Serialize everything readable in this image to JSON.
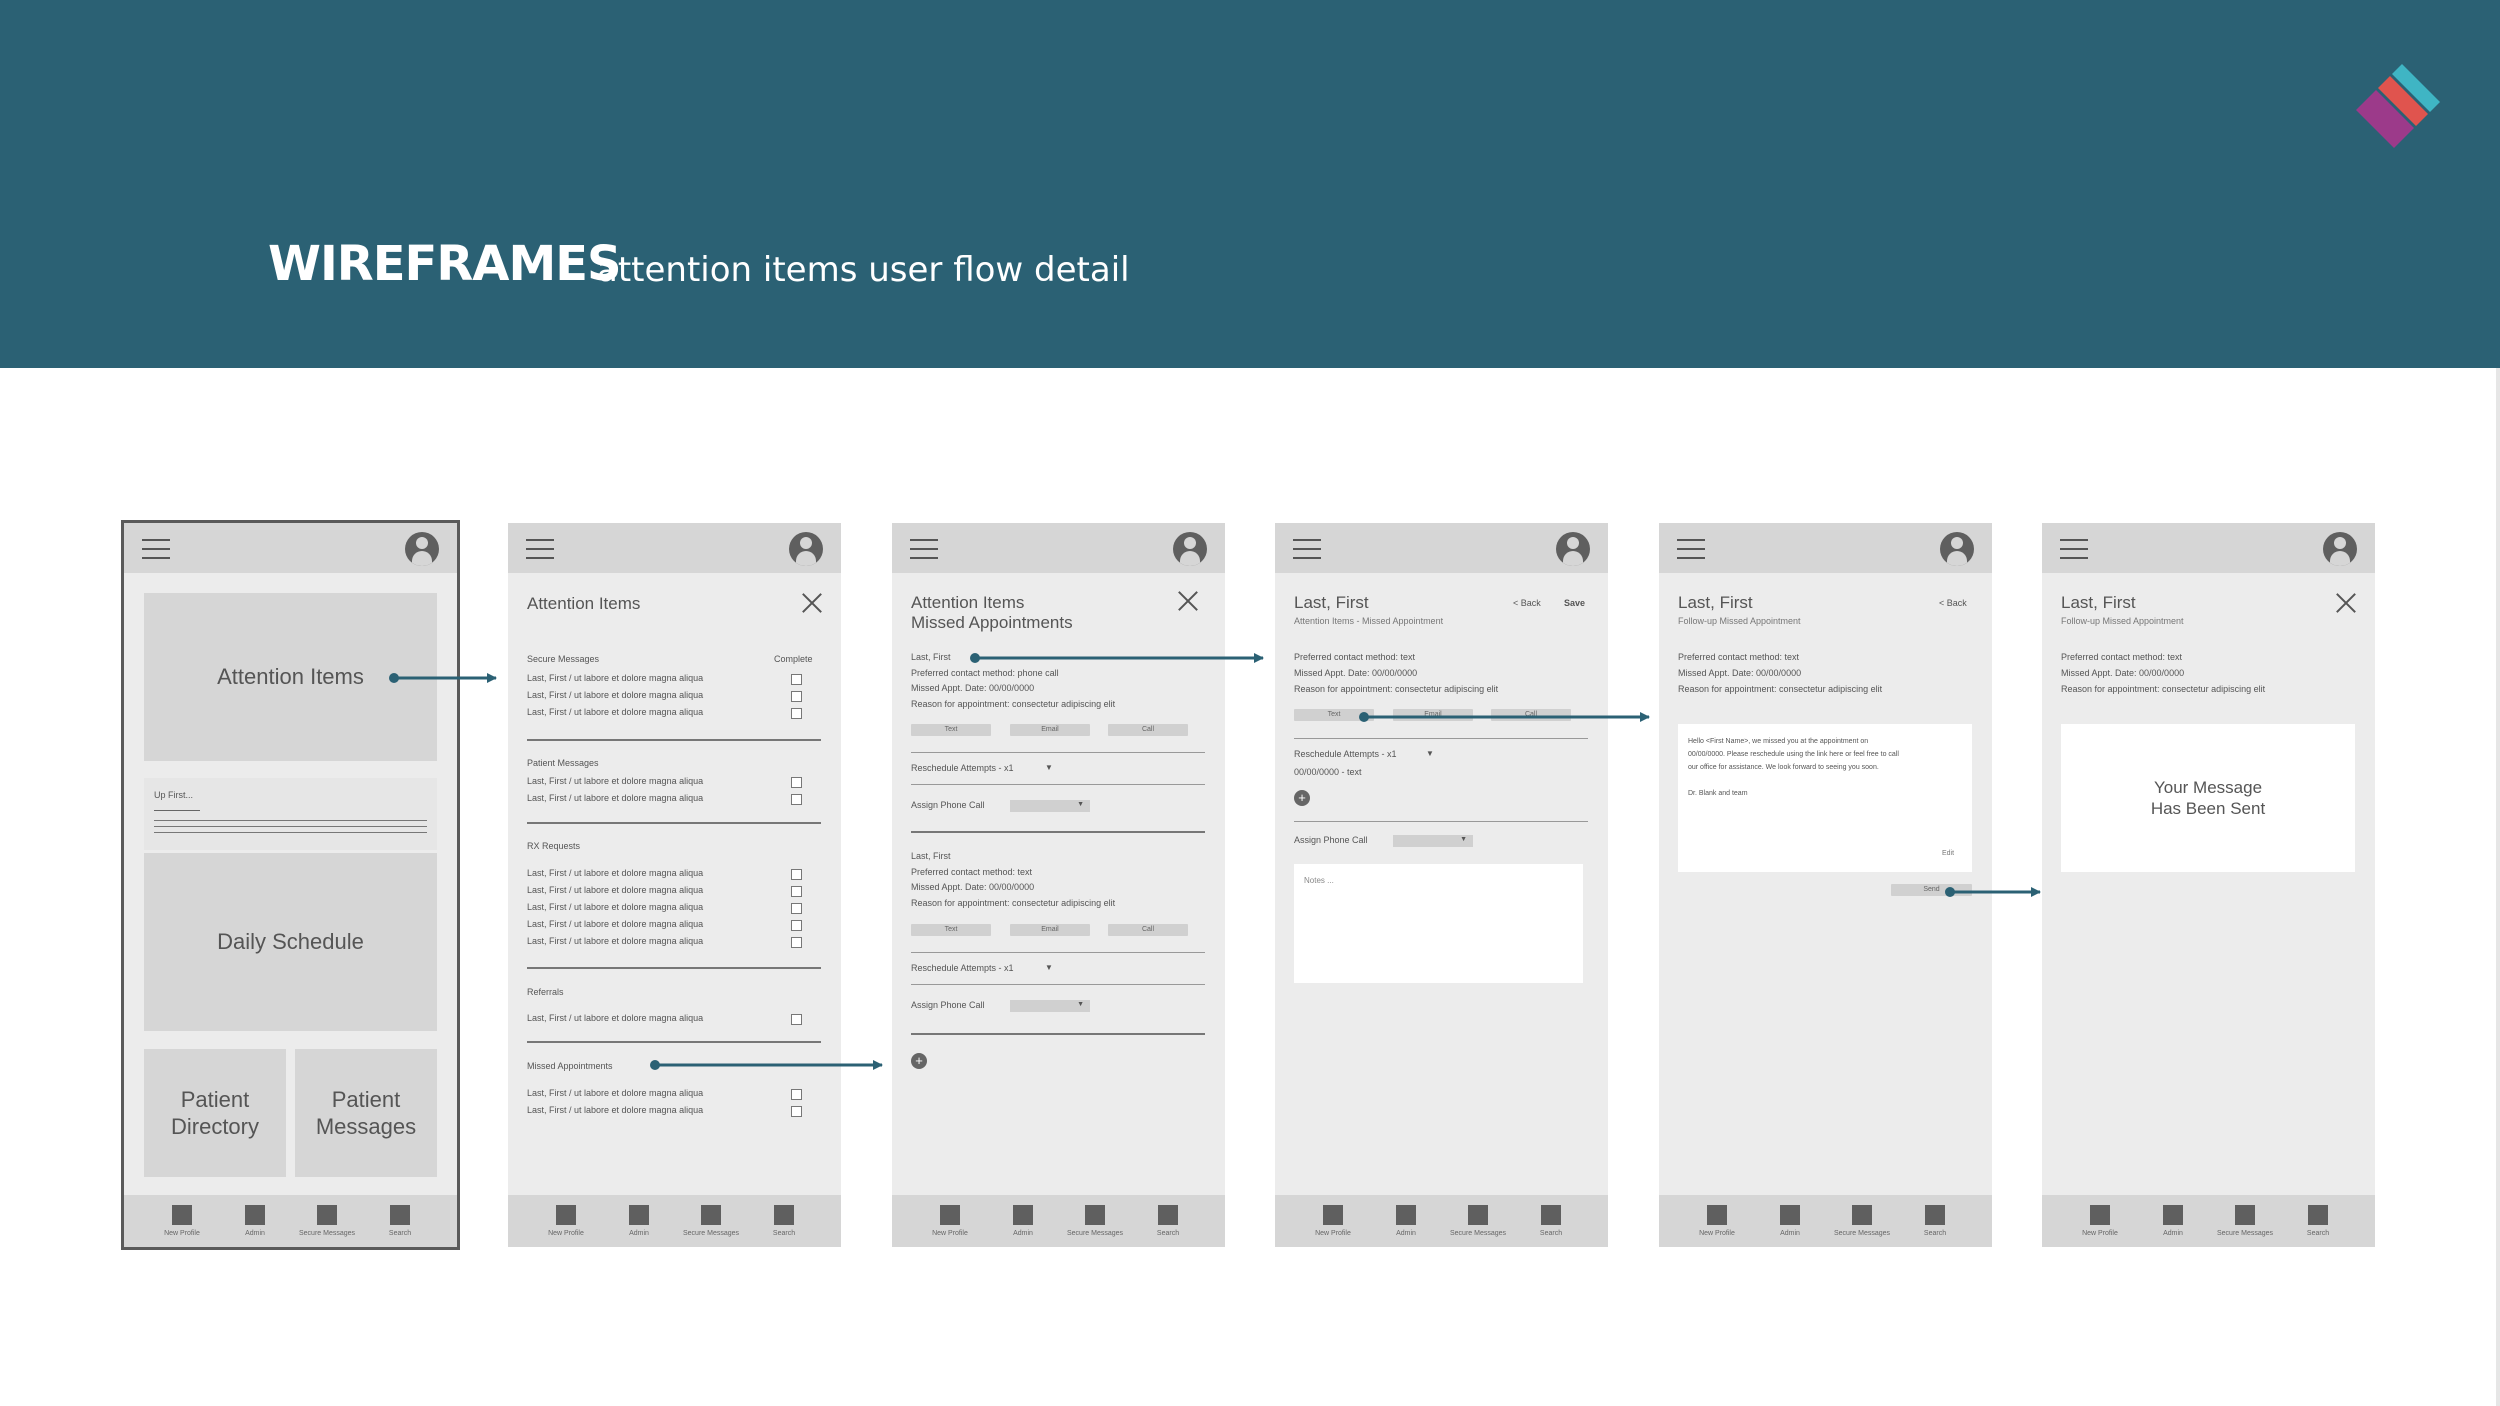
{
  "header": {
    "title": "WIREFRAMES",
    "subtitle": "attention items user flow detail"
  },
  "colors": {
    "banner": "#2b6174",
    "arrow": "#2b6174",
    "logo": [
      "#3fb5c4",
      "#e0544e",
      "#9c3a8a"
    ]
  },
  "nav_labels": [
    "New Profile",
    "Admin",
    "Secure Messages",
    "Search"
  ],
  "screen1": {
    "attention_items": "Attention Items",
    "up_first": "Up First...",
    "daily_schedule": "Daily Schedule",
    "patient_directory_1": "Patient",
    "patient_directory_2": "Directory",
    "patient_messages_1": "Patient",
    "patient_messages_2": "Messages"
  },
  "screen2": {
    "title": "Attention Items",
    "complete": "Complete",
    "item_text": "Last, First / ut labore et dolore magna aliqua",
    "sections": {
      "secure": "Secure Messages",
      "patient": "Patient Messages",
      "rx": "RX Requests",
      "referrals": "Referrals",
      "missed": "Missed Appointments"
    }
  },
  "screen3": {
    "title1": "Attention Items",
    "title2": "Missed Appointments",
    "name": "Last, First",
    "contact_phone": "Preferred contact method: phone call",
    "contact_text": "Preferred contact method: text",
    "missed_date": "Missed Appt. Date: 00/00/0000",
    "reason": "Reason for appointment: consectetur adipiscing elit",
    "btn_text": "Text",
    "btn_email": "Email",
    "btn_call": "Call",
    "reschedule": "Reschedule Attempts - x1",
    "assign": "Assign Phone Call"
  },
  "screen4": {
    "name": "Last, First",
    "sub": "Attention Items - Missed Appointment",
    "back": "< Back",
    "save": "Save",
    "contact": "Preferred contact method: text",
    "missed_date": "Missed Appt. Date: 00/00/0000",
    "reason": "Reason for appointment: consectetur adipiscing elit",
    "reschedule": "Reschedule Attempts - x1",
    "reschedule_entry": "00/00/0000 - text",
    "assign": "Assign Phone Call",
    "notes": "Notes ..."
  },
  "screen5": {
    "name": "Last, First",
    "sub": "Follow-up Missed Appointment",
    "back": "< Back",
    "msg1": "Hello <First Name>, we missed you at the appointment on",
    "msg2": "00/00/0000. Please reschedule using the link here or feel free to call",
    "msg3": "our office for assistance. We look forward to seeing you soon.",
    "msg4": "Dr. Blank and team",
    "edit": "Edit",
    "send": "Send"
  },
  "screen6": {
    "name": "Last, First",
    "sub": "Follow-up Missed Appointment",
    "confirm1": "Your Message",
    "confirm2": "Has Been Sent"
  }
}
